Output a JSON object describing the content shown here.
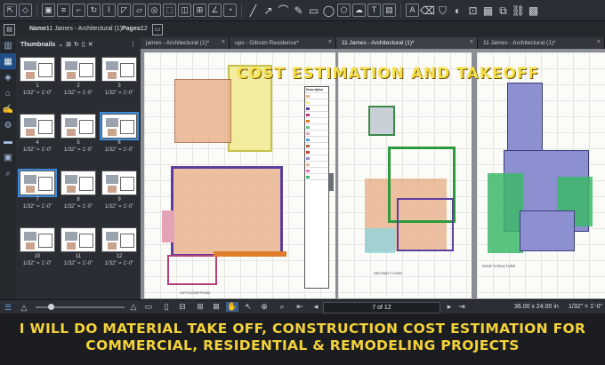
{
  "toolbar": {
    "icons": [
      "select-icon",
      "pan-icon",
      "snapshot-icon",
      "markup-list-icon",
      "crop-icon",
      "rotate-icon",
      "polyline-icon",
      "area-icon",
      "perimeter-icon",
      "count-icon",
      "volume-icon",
      "cutout-icon",
      "dimension-icon",
      "angle-icon",
      "radius-icon",
      "line-icon",
      "arrow-icon",
      "arc-icon",
      "pen-icon",
      "rectangle-icon",
      "ellipse-icon",
      "polygon-icon",
      "cloud-icon",
      "text-box-icon",
      "callout-icon",
      "highlighter-icon",
      "eraser-icon",
      "stamp-icon",
      "color-icon",
      "fill-icon"
    ]
  },
  "infobar": {
    "name_label": "Name:",
    "name_value": "11 James - Architectural (1)",
    "pages_label": "Pages:",
    "pages_value": "12"
  },
  "thumbnails": {
    "title": "Thumbnails",
    "items": [
      {
        "num": "1",
        "scale": "1/32\" = 1'-0\""
      },
      {
        "num": "2",
        "scale": "1/32\" = 1'-0\""
      },
      {
        "num": "3",
        "scale": "1/32\" = 1'-0\""
      },
      {
        "num": "4",
        "scale": "1/32\" = 1'-0\""
      },
      {
        "num": "5",
        "scale": "1/32\" = 1'-0\""
      },
      {
        "num": "6",
        "scale": "1/32\" = 1'-0\""
      },
      {
        "num": "7",
        "scale": "1/32\" = 1'-0\""
      },
      {
        "num": "8",
        "scale": "1/32\" = 1'-0\""
      },
      {
        "num": "9",
        "scale": "1/32\" = 1'-0\""
      },
      {
        "num": "10",
        "scale": "1/32\" = 1'-0\""
      },
      {
        "num": "11",
        "scale": "1/32\" = 1'-0\""
      },
      {
        "num": "12",
        "scale": "1/32\" = 1'-0\""
      }
    ]
  },
  "tabs": [
    {
      "label": "james - Architectural (1)*"
    },
    {
      "label": "ups - Gibson Residence*"
    },
    {
      "label": "11 James - Architectural (1)*"
    },
    {
      "label": "11 James - Architectural (1)*"
    }
  ],
  "canvas": {
    "banner": "COST ESTIMATION AND TAKEOFF",
    "legend_title": "Description",
    "sheet1_label": "1ST FLOOR PLAN",
    "sheet2_label": "SECOND FLOOR",
    "sheet3_label": "ROOF STRUCTURE"
  },
  "statusbar": {
    "page_field": "7 of 12",
    "dimensions": "36.00 x 24.00 in",
    "scale": "1/32\" = 1'-0\""
  },
  "caption": {
    "line1": "I WILL DO MATERIAL TAKE OFF, CONSTRUCTION COST ESTIMATION FOR",
    "line2": "COMMERCIAL, RESIDENTIAL & REMODELING PROJECTS"
  },
  "colors": {
    "accent": "#3d8bd9",
    "caption_text": "#f4d23a",
    "banner_text": "#f6e04a",
    "room_tan": "#e8b48f",
    "room_purple": "#5b3f9e",
    "roof_blue": "#8c8fd0",
    "roof_green": "#3db86a"
  }
}
